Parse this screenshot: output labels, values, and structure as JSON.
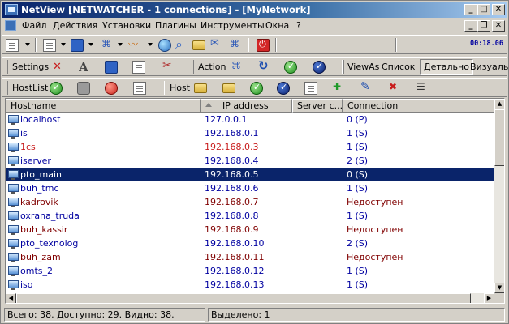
{
  "window": {
    "title": "NetView [NETWATCHER - 1 connections] - [MyNetwork]",
    "buttons": {
      "minimize": "_",
      "maximize": "□",
      "close": "✕"
    }
  },
  "menubar": {
    "items": [
      "Файл",
      "Действия",
      "Установки",
      "Плагины",
      "Инструменты",
      "Окна",
      "?"
    ],
    "mdi_buttons": {
      "minimize": "_",
      "restore": "❐",
      "close": "✕"
    }
  },
  "toolbar1": {
    "clock": "00:18.06"
  },
  "toolbar2": {
    "settings_label": "Settings",
    "action_label": "Action",
    "viewas_label": "ViewAs",
    "view_list": "Список",
    "view_detail": "Детально",
    "view_visual": "Визуаль"
  },
  "toolbar3": {
    "hostlist_label": "HostList",
    "host_label": "Host"
  },
  "list": {
    "columns": [
      "Hostname",
      "IP address",
      "Server c...",
      "Connection"
    ],
    "rows": [
      {
        "hostname": "localhost",
        "ip": "127.0.0.1",
        "connection": "0 (P)",
        "state": "online"
      },
      {
        "hostname": "is",
        "ip": "192.168.0.1",
        "connection": "1 (S)",
        "state": "online"
      },
      {
        "hostname": "1cs",
        "ip": "192.168.0.3",
        "connection": "1 (S)",
        "state": "warn"
      },
      {
        "hostname": "iserver",
        "ip": "192.168.0.4",
        "connection": "2 (S)",
        "state": "online"
      },
      {
        "hostname": "pto_main",
        "ip": "192.168.0.5",
        "connection": "0 (S)",
        "state": "selected"
      },
      {
        "hostname": "buh_tmc",
        "ip": "192.168.0.6",
        "connection": "1 (S)",
        "state": "online"
      },
      {
        "hostname": "kadrovik",
        "ip": "192.168.0.7",
        "connection": "Недоступен",
        "state": "offline"
      },
      {
        "hostname": "oxrana_truda",
        "ip": "192.168.0.8",
        "connection": "1 (S)",
        "state": "online"
      },
      {
        "hostname": "buh_kassir",
        "ip": "192.168.0.9",
        "connection": "Недоступен",
        "state": "offline"
      },
      {
        "hostname": "pto_texnolog",
        "ip": "192.168.0.10",
        "connection": "2 (S)",
        "state": "online"
      },
      {
        "hostname": "buh_zam",
        "ip": "192.168.0.11",
        "connection": "Недоступен",
        "state": "offline"
      },
      {
        "hostname": "omts_2",
        "ip": "192.168.0.12",
        "connection": "1 (S)",
        "state": "online"
      },
      {
        "hostname": "iso",
        "ip": "192.168.0.13",
        "connection": "1 (S)",
        "state": "online"
      }
    ]
  },
  "statusbar": {
    "totals": "Всего: 38. Доступно: 29. Видно: 38.",
    "selected": "Выделено: 1"
  }
}
